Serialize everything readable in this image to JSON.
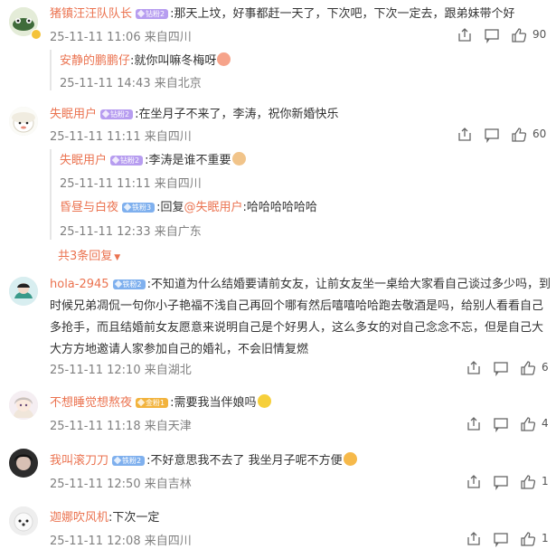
{
  "comments": [
    {
      "user": "猪镇汪汪队队长",
      "badge": "钻粉2",
      "text": ":那天上坟，好事都赶一天了，下次吧，下次一定去，跟弟妹带个好",
      "time": "25-11-11 11:06 来自四川",
      "likes": "90",
      "replies": [
        {
          "user": "安静的鹏鹏仔",
          "text": ":就你叫嘛冬梅呀",
          "time": "25-11-11 14:43 来自北京"
        }
      ]
    },
    {
      "user": "失眠用户",
      "badge": "钻粉2",
      "text": ":在坐月子不来了，李涛，祝你新婚快乐",
      "time": "25-11-11 11:11 来自四川",
      "likes": "60",
      "replies": [
        {
          "user": "失眠用户",
          "badge": "钻粉2",
          "text": ":李涛是谁不重要",
          "time": "25-11-11 11:11 来自四川"
        },
        {
          "user": "昏昼与白夜",
          "badge": "铁粉3",
          "prefix": ":回复",
          "mention": "@失眠用户",
          "text": ":哈哈哈哈哈哈",
          "time": "25-11-11 12:33 来自广东"
        }
      ],
      "more": "共3条回复"
    },
    {
      "user": "hola-2945",
      "badge": "铁粉2",
      "text_lines": [
        ":不知道为什么结婚要请前女友，让前女友坐一桌给大家看自己谈过多少吗，到",
        "时候兄弟凋侃一句你小子艳福不浅自己再回个哪有然后嘻嘻哈哈跑去敬酒是吗，给别人看看自己",
        "多抢手，而且结婚前女友愿意来说明自己是个好男人，这么多女的对自己念念不忘，但是自己大",
        "大方方地邀请人家参加自己的婚礼，不会旧情复燃"
      ],
      "time": "25-11-11 12:10 来自湖北",
      "likes": "6"
    },
    {
      "user": "不想睡觉想熬夜",
      "badge": "金粉1",
      "text": ":需要我当伴娘吗",
      "time": "25-11-11 11:18 来自天津",
      "likes": "4"
    },
    {
      "user": "我叫滚刀刀",
      "badge": "铁粉2",
      "text": ":不好意思我不去了 我坐月子呢不方便",
      "time": "25-11-11 12:50 来自吉林",
      "likes": "1"
    },
    {
      "user": "迦娜吹风机",
      "text": ":下次一定",
      "time": "25-11-11 12:08 来自四川",
      "likes": "1"
    }
  ],
  "colors": {
    "username": "#eb7350",
    "meta": "#808080",
    "badge_purple": "#b79df0",
    "badge_blue": "#7fb0ee",
    "badge_gold": "#f2b33d"
  },
  "icons": [
    "share-icon",
    "comment-icon",
    "like-icon"
  ]
}
